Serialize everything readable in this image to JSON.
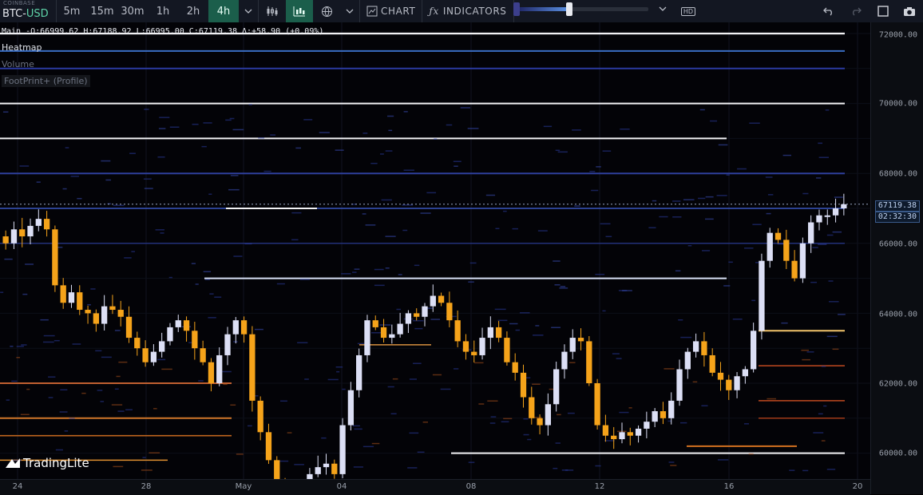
{
  "symbol": {
    "exchange": "COINBASE",
    "base": "BTC",
    "dash": "-",
    "quote": "USD"
  },
  "timeframes": [
    {
      "label": "5m",
      "active": false
    },
    {
      "label": "15m",
      "active": false
    },
    {
      "label": "30m",
      "active": false
    },
    {
      "label": "1h",
      "active": false
    },
    {
      "label": "2h",
      "active": false
    },
    {
      "label": "4h",
      "active": true
    }
  ],
  "toolbar": {
    "chart_label": "CHART",
    "indicators_label": "INDICATORS",
    "hd_label": "HD",
    "slider_value": 0.4
  },
  "legend": {
    "main": "Main -O:66999.62 H:67188.92 L:66995.00 C:67119.38 Δ:+58.90 (+0.09%)",
    "heatmap": "Heatmap",
    "volume": "Volume",
    "footprint": "FootPrint+ (Profile)"
  },
  "price_axis": [
    "72000.00",
    "70000.00",
    "68000.00",
    "66000.00",
    "64000.00",
    "62000.00",
    "60000.00"
  ],
  "time_axis": [
    "24",
    "28",
    "May",
    "04",
    "08",
    "12",
    "16",
    "20"
  ],
  "current_price": {
    "price": "67119.38",
    "countdown": "02:32:30"
  },
  "logo": "TradingLite",
  "colors": {
    "bull": "#dcdff5",
    "bear": "#f5a31a",
    "active_tab": "#1b5e4b"
  },
  "chart_data": {
    "type": "candlestick",
    "ylim": [
      59400,
      72600
    ],
    "closes": [
      66000,
      66400,
      66200,
      66500,
      66700,
      66400,
      64800,
      64300,
      64600,
      64100,
      64000,
      63700,
      64200,
      64100,
      63900,
      63300,
      63000,
      62600,
      62900,
      63200,
      63600,
      63800,
      63500,
      63000,
      62600,
      62000,
      62800,
      63400,
      63800,
      63400,
      61500,
      60600,
      59800,
      59000,
      58700,
      58600,
      59000,
      59400,
      59600,
      59700,
      59400,
      60800,
      61800,
      62800,
      63800,
      63600,
      63300,
      63400,
      63700,
      64000,
      63900,
      64200,
      64500,
      64300,
      63800,
      63200,
      62900,
      62800,
      63300,
      63600,
      63300,
      62600,
      62300,
      61600,
      61000,
      60800,
      61400,
      62400,
      62900,
      63300,
      63200,
      62000,
      60800,
      60500,
      60400,
      60600,
      60500,
      60700,
      60900,
      61200,
      61000,
      61500,
      62400,
      62900,
      63200,
      62800,
      62300,
      62100,
      61800,
      62200,
      62400,
      63500,
      65500,
      66300,
      66100,
      65500,
      65000,
      66000,
      66600,
      66800,
      66800,
      67000,
      67119
    ],
    "bull_color": "#dcdff5",
    "bear_color": "#f5a31a"
  }
}
